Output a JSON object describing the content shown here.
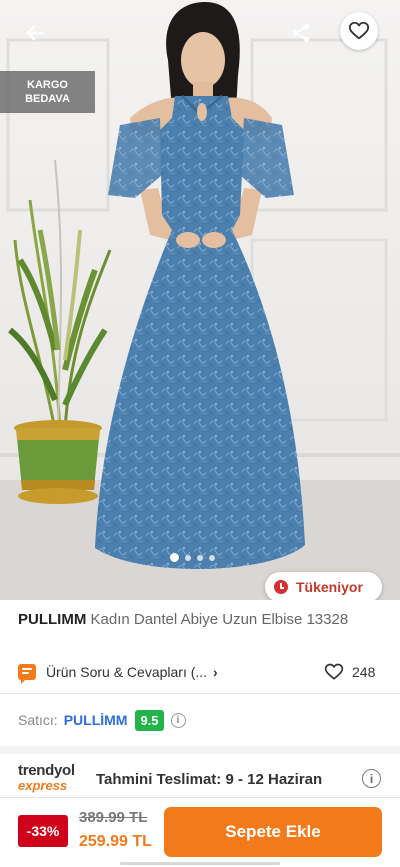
{
  "header": {
    "back_icon": "arrow-left-icon",
    "share_icon": "share-icon",
    "favorite_icon": "heart-outline-icon"
  },
  "gallery": {
    "badge_line1": "KARGO",
    "badge_line2": "BEDAVA",
    "total_images": 4,
    "active_image_index": 0,
    "stock_label": "Tükeniyor"
  },
  "product": {
    "brand": "PULLIMM",
    "name": "Kadın Dantel Abiye Uzun Elbise 13328"
  },
  "qa": {
    "label": "Ürün Soru & Cevapları (...",
    "chevron": "›",
    "like_count": "248"
  },
  "seller": {
    "label": "Satıcı:",
    "name": "PULLİMM",
    "score": "9.5",
    "info": "i"
  },
  "delivery": {
    "logo_top": "trendyol",
    "logo_bottom": "express",
    "text": "Tahmini Teslimat: 9 - 12 Haziran",
    "info": "i"
  },
  "price": {
    "discount": "-33%",
    "old": "389.99 TL",
    "new": "259.99 TL"
  },
  "cart_button": "Sepete Ekle",
  "colors": {
    "accent": "#f27a1a",
    "discount": "#d0021b",
    "score": "#24b24b",
    "seller_link": "#2d6fd6",
    "dress": "#4a7fae"
  }
}
